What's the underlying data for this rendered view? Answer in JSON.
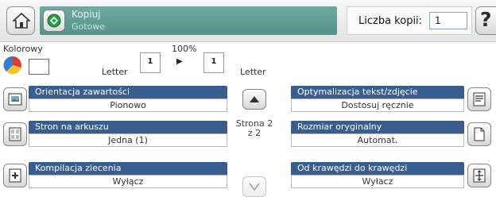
{
  "header": {
    "title": "Kopiuj",
    "status": "Gotowe",
    "copies_label": "Liczba kopii:",
    "copies_value": "1",
    "help_glyph": "?"
  },
  "mode": {
    "color_label": "Kolorowy",
    "zoom_label": "100%",
    "source_size": "Letter",
    "dest_size": "Letter",
    "source_count": "1",
    "dest_count": "1",
    "arrow_glyph": "▶"
  },
  "options_left": [
    {
      "label": "Orientacja zawartości",
      "value": "Pionowo",
      "icon": "orientation-icon"
    },
    {
      "label": "Stron na arkuszu",
      "value": "Jedna (1)",
      "icon": "pages-per-sheet-icon"
    },
    {
      "label": "Kompilacja zlecenia",
      "value": "Wyłącz",
      "icon": "job-build-icon"
    }
  ],
  "options_right": [
    {
      "label": "Optymalizacja tekst/zdjęcie",
      "value": "Dostosuj ręcznie",
      "icon": "optimize-icon"
    },
    {
      "label": "Rozmiar oryginalny",
      "value": "Automat.",
      "icon": "original-size-icon"
    },
    {
      "label": "Od krawędzi do krawędzi",
      "value": "Wyłacz",
      "icon": "edge-to-edge-icon"
    }
  ],
  "pager": {
    "line1": "Strona 2",
    "line2": "z 2"
  },
  "colors": {
    "header_teal": "#5f9b93",
    "option_blue": "#3a5d8f"
  }
}
